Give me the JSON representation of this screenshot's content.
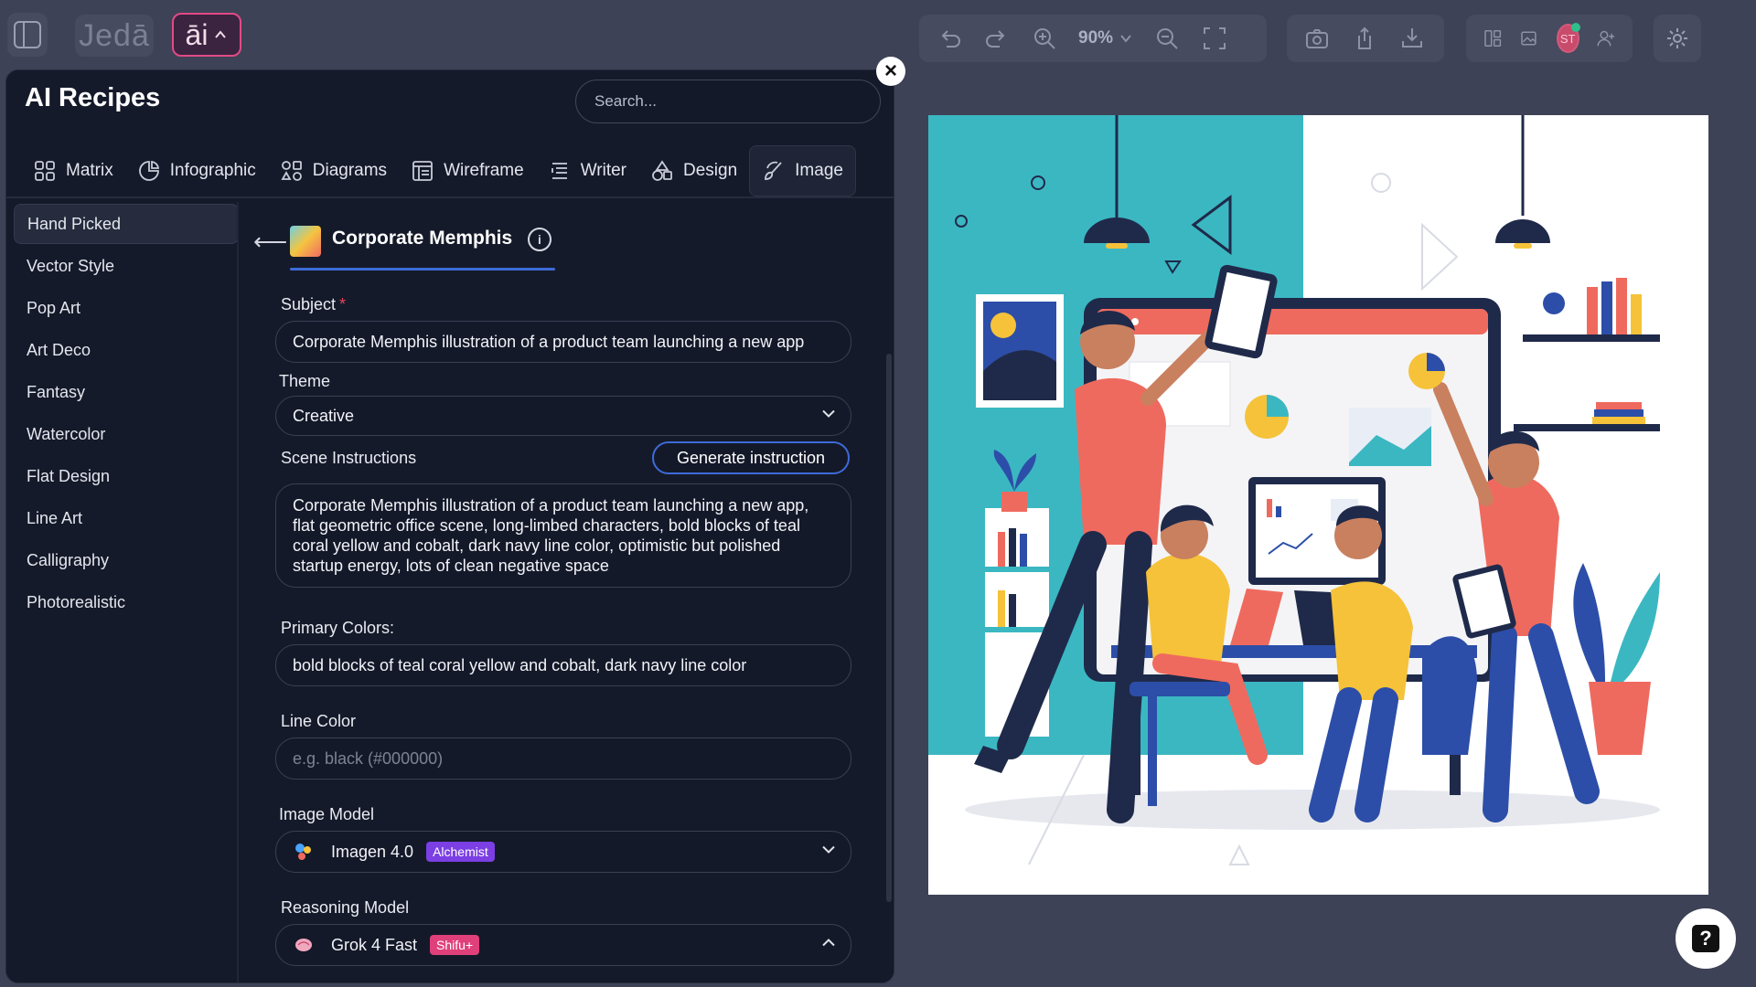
{
  "topbar": {
    "brand": "Jedā",
    "ai_label": "āi",
    "zoom": "90%"
  },
  "user": {
    "initials": "ST"
  },
  "panel": {
    "title": "AI Recipes",
    "search_placeholder": "Search...",
    "tabs": [
      {
        "label": "Matrix",
        "icon": "matrix-icon"
      },
      {
        "label": "Infographic",
        "icon": "pie-chart-icon"
      },
      {
        "label": "Diagrams",
        "icon": "diagram-icon"
      },
      {
        "label": "Wireframe",
        "icon": "wireframe-icon"
      },
      {
        "label": "Writer",
        "icon": "writer-icon"
      },
      {
        "label": "Design",
        "icon": "shapes-icon"
      },
      {
        "label": "Image",
        "icon": "brush-icon",
        "active": true
      }
    ],
    "categories": [
      "Hand Picked",
      "Vector Style",
      "Pop Art",
      "Art Deco",
      "Fantasy",
      "Watercolor",
      "Flat Design",
      "Line Art",
      "Calligraphy",
      "Photorealistic"
    ],
    "active_category": "Hand Picked"
  },
  "recipe": {
    "title": "Corporate Memphis",
    "subject": {
      "label": "Subject",
      "value": "Corporate Memphis illustration of a product team launching a new app"
    },
    "theme": {
      "label": "Theme",
      "value": "Creative"
    },
    "scene": {
      "label": "Scene Instructions",
      "button": "Generate instruction",
      "value": "Corporate Memphis illustration of a product team launching a new app, flat geometric office scene, long-limbed characters, bold blocks of teal coral yellow and cobalt, dark navy line color, optimistic but polished startup energy, lots of clean negative space"
    },
    "primary_colors": {
      "label": "Primary Colors:",
      "value": "bold blocks of teal coral yellow and cobalt, dark navy line color"
    },
    "line_color": {
      "label": "Line Color",
      "placeholder": "e.g. black (#000000)"
    },
    "image_model": {
      "label": "Image Model",
      "value": "Imagen 4.0",
      "badge": "Alchemist"
    },
    "reasoning_model": {
      "label": "Reasoning Model",
      "value": "Grok 4 Fast",
      "badge": "Shifu+"
    }
  },
  "colors": {
    "accent_pink": "#e24a86",
    "accent_blue": "#3d6bd8",
    "teal": "#3bb7c2",
    "coral": "#ef6a5e",
    "yellow": "#f5c23a",
    "cobalt": "#2c4ea8",
    "navy": "#1f2a4a"
  }
}
